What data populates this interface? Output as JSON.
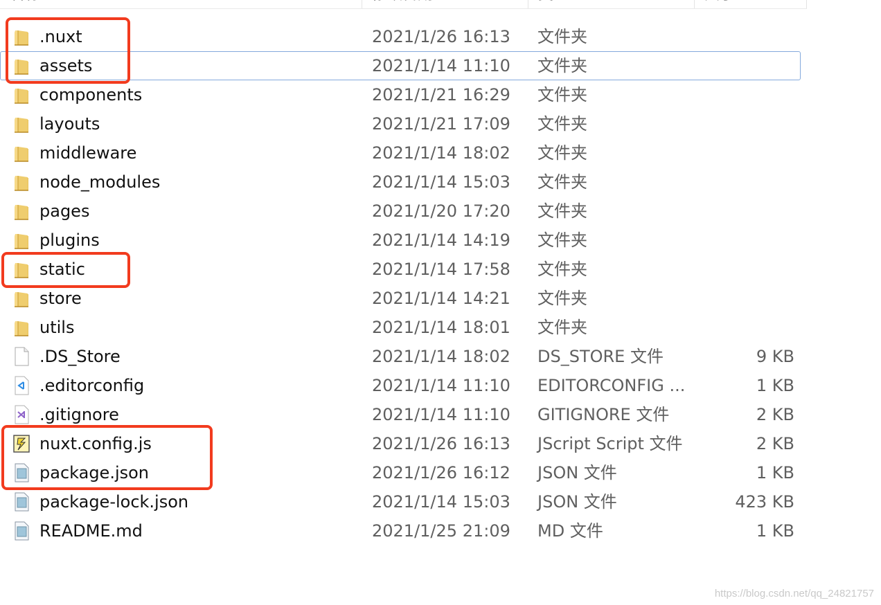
{
  "columns": {
    "name": "名称",
    "date": "修改日期",
    "type": "类型",
    "size": "大小"
  },
  "files": [
    {
      "name": ".nuxt",
      "date": "2021/1/26 16:13",
      "type": "文件夹",
      "size": "",
      "icon": "folder-icon",
      "selected": false
    },
    {
      "name": "assets",
      "date": "2021/1/14 11:10",
      "type": "文件夹",
      "size": "",
      "icon": "folder-icon",
      "selected": true
    },
    {
      "name": "components",
      "date": "2021/1/21 16:29",
      "type": "文件夹",
      "size": "",
      "icon": "folder-icon",
      "selected": false
    },
    {
      "name": "layouts",
      "date": "2021/1/21 17:09",
      "type": "文件夹",
      "size": "",
      "icon": "folder-icon",
      "selected": false
    },
    {
      "name": "middleware",
      "date": "2021/1/14 18:02",
      "type": "文件夹",
      "size": "",
      "icon": "folder-icon",
      "selected": false
    },
    {
      "name": "node_modules",
      "date": "2021/1/14 15:03",
      "type": "文件夹",
      "size": "",
      "icon": "folder-icon",
      "selected": false
    },
    {
      "name": "pages",
      "date": "2021/1/20 17:20",
      "type": "文件夹",
      "size": "",
      "icon": "folder-icon",
      "selected": false
    },
    {
      "name": "plugins",
      "date": "2021/1/14 14:19",
      "type": "文件夹",
      "size": "",
      "icon": "folder-icon",
      "selected": false
    },
    {
      "name": "static",
      "date": "2021/1/14 17:58",
      "type": "文件夹",
      "size": "",
      "icon": "folder-icon",
      "selected": false
    },
    {
      "name": "store",
      "date": "2021/1/14 14:21",
      "type": "文件夹",
      "size": "",
      "icon": "folder-icon",
      "selected": false
    },
    {
      "name": "utils",
      "date": "2021/1/14 18:01",
      "type": "文件夹",
      "size": "",
      "icon": "folder-icon",
      "selected": false
    },
    {
      "name": ".DS_Store",
      "date": "2021/1/14 18:02",
      "type": "DS_STORE 文件",
      "size": "9 KB",
      "icon": "blank-file-icon",
      "selected": false
    },
    {
      "name": ".editorconfig",
      "date": "2021/1/14 11:10",
      "type": "EDITORCONFIG ...",
      "size": "1 KB",
      "icon": "vscode-file-icon",
      "selected": false
    },
    {
      "name": ".gitignore",
      "date": "2021/1/14 11:10",
      "type": "GITIGNORE 文件",
      "size": "2 KB",
      "icon": "vs-file-icon",
      "selected": false
    },
    {
      "name": "nuxt.config.js",
      "date": "2021/1/26 16:13",
      "type": "JScript Script 文件",
      "size": "2 KB",
      "icon": "jscript-file-icon",
      "selected": false
    },
    {
      "name": "package.json",
      "date": "2021/1/26 16:12",
      "type": "JSON 文件",
      "size": "1 KB",
      "icon": "text-file-icon",
      "selected": false
    },
    {
      "name": "package-lock.json",
      "date": "2021/1/14 15:03",
      "type": "JSON 文件",
      "size": "423 KB",
      "icon": "text-file-icon",
      "selected": false
    },
    {
      "name": "README.md",
      "date": "2021/1/25 21:09",
      "type": "MD 文件",
      "size": "1 KB",
      "icon": "text-file-icon",
      "selected": false
    }
  ],
  "highlight_color": "#f23b1e",
  "selection_color": "#84a9dc",
  "watermark": "https://blog.csdn.net/qq_24821757"
}
